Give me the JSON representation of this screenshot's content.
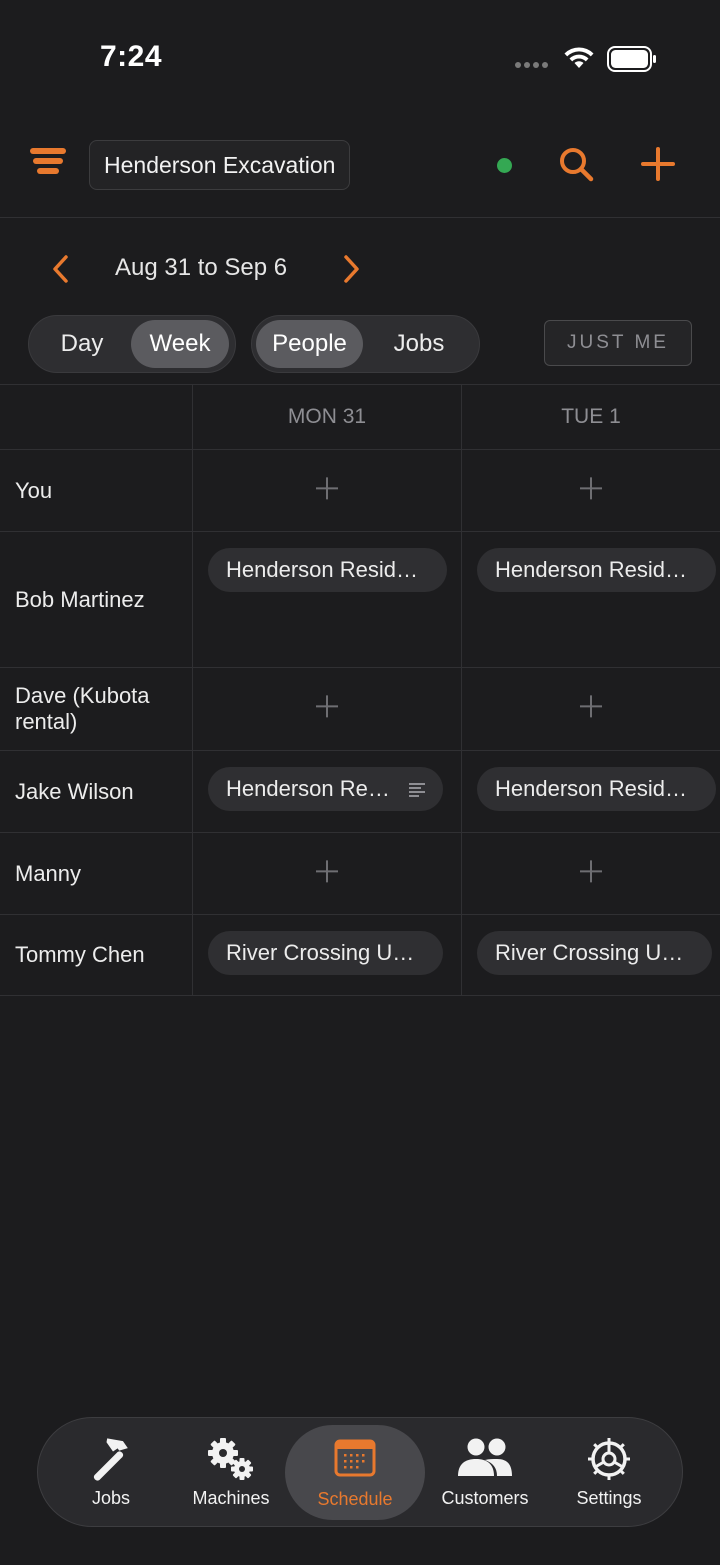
{
  "status_bar": {
    "time": "7:24"
  },
  "header": {
    "company": "Henderson Excavation"
  },
  "date_nav": {
    "range": "Aug 31 to Sep 6"
  },
  "view_toggle": {
    "day": "Day",
    "week": "Week",
    "selected": "Week"
  },
  "mode_toggle": {
    "people": "People",
    "jobs": "Jobs",
    "selected": "People"
  },
  "filter": {
    "just_me": "JUST ME"
  },
  "grid": {
    "days": [
      "MON 31",
      "TUE 1"
    ],
    "rows": [
      {
        "name": "You",
        "mon": "",
        "tue": ""
      },
      {
        "name": "Bob Martinez",
        "mon": "Henderson Resid…",
        "tue": "Henderson Resid…"
      },
      {
        "name": "Dave (Kubota rental)",
        "mon": "",
        "tue": ""
      },
      {
        "name": "Jake Wilson",
        "mon": "Henderson Re…",
        "tue": "Henderson Resid…"
      },
      {
        "name": "Manny",
        "mon": "",
        "tue": ""
      },
      {
        "name": "Tommy Chen",
        "mon": "River Crossing U…",
        "tue": "River Crossing U…"
      }
    ]
  },
  "tab_bar": {
    "tabs": [
      {
        "label": "Jobs",
        "icon": "hammer-icon"
      },
      {
        "label": "Machines",
        "icon": "gears-icon"
      },
      {
        "label": "Schedule",
        "icon": "calendar-icon"
      },
      {
        "label": "Customers",
        "icon": "people-icon"
      },
      {
        "label": "Settings",
        "icon": "settings-icon"
      }
    ],
    "active": "Schedule"
  },
  "colors": {
    "accent": "#e8792e",
    "background": "#1c1c1e",
    "online": "#34a853"
  }
}
